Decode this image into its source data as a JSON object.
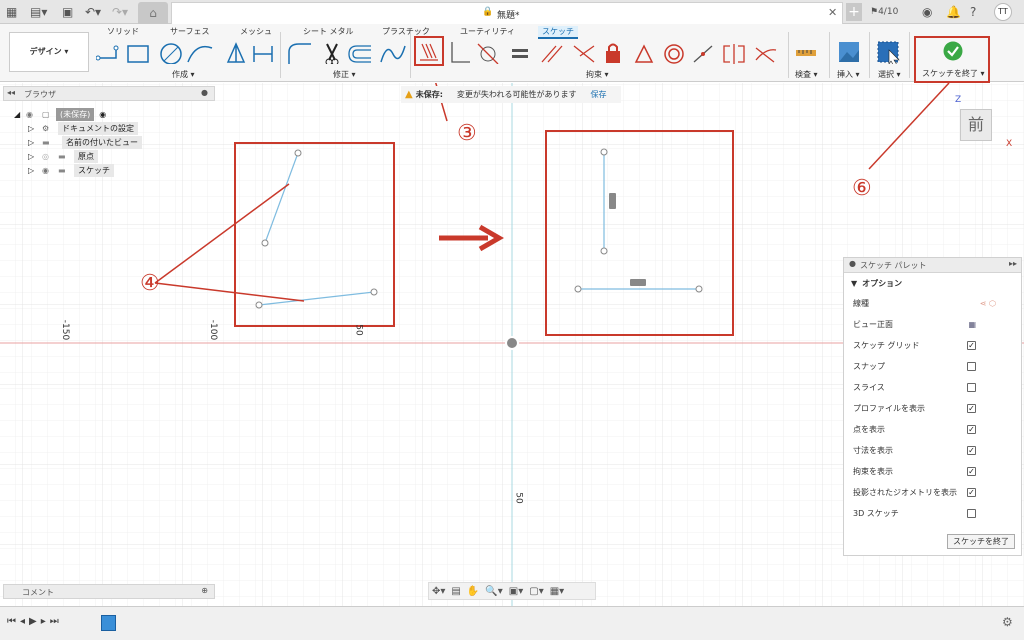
{
  "window": {
    "title": "無題*",
    "job_count": "4/10",
    "user_initials": "TT"
  },
  "ribbon": {
    "workspace_label": "デザイン",
    "tabs": [
      "ソリッド",
      "サーフェス",
      "メッシュ",
      "シート メタル",
      "プラスチック",
      "ユーティリティ",
      "スケッチ"
    ],
    "groups": {
      "create": "作成",
      "modify": "修正",
      "constraints": "拘束",
      "inspect": "検査",
      "insert": "挿入",
      "select": "選択"
    },
    "finish_sketch": "スケッチを終了"
  },
  "warning": {
    "label": "未保存:",
    "message": "変更が失われる可能性があります",
    "save": "保存"
  },
  "browser": {
    "title": "ブラウザ",
    "items": [
      {
        "label": "(未保存)",
        "icon": "document-icon"
      },
      {
        "label": "ドキュメントの設定",
        "icon": "gear-icon"
      },
      {
        "label": "名前の付いたビュー",
        "icon": "folder-icon"
      },
      {
        "label": "原点",
        "icon": "folder-icon"
      },
      {
        "label": "スケッチ",
        "icon": "folder-icon"
      }
    ]
  },
  "comments": {
    "title": "コメント"
  },
  "axis_ticks": {
    "x1": "-150",
    "x2": "-100",
    "x3": "50",
    "y1": "50"
  },
  "viewcube": {
    "face": "前",
    "z": "Z",
    "x": "X"
  },
  "annotations": {
    "n3": "③",
    "n4": "④",
    "n6": "⑥"
  },
  "palette": {
    "title": "スケッチ パレット",
    "section": "オプション",
    "rows": [
      {
        "label": "線種",
        "type": "icons"
      },
      {
        "label": "ビュー正面",
        "type": "icon"
      },
      {
        "label": "スケッチ グリッド",
        "checked": true
      },
      {
        "label": "スナップ",
        "checked": false
      },
      {
        "label": "スライス",
        "checked": false
      },
      {
        "label": "プロファイルを表示",
        "checked": true
      },
      {
        "label": "点を表示",
        "checked": true
      },
      {
        "label": "寸法を表示",
        "checked": true
      },
      {
        "label": "拘束を表示",
        "checked": true
      },
      {
        "label": "投影されたジオメトリを表示",
        "checked": true
      },
      {
        "label": "3D スケッチ",
        "checked": false
      }
    ],
    "finish_button": "スケッチを終了"
  },
  "colors": {
    "accent": "#1a6fb0",
    "annotation": "#c9392b",
    "finish_green": "#3aa845"
  }
}
